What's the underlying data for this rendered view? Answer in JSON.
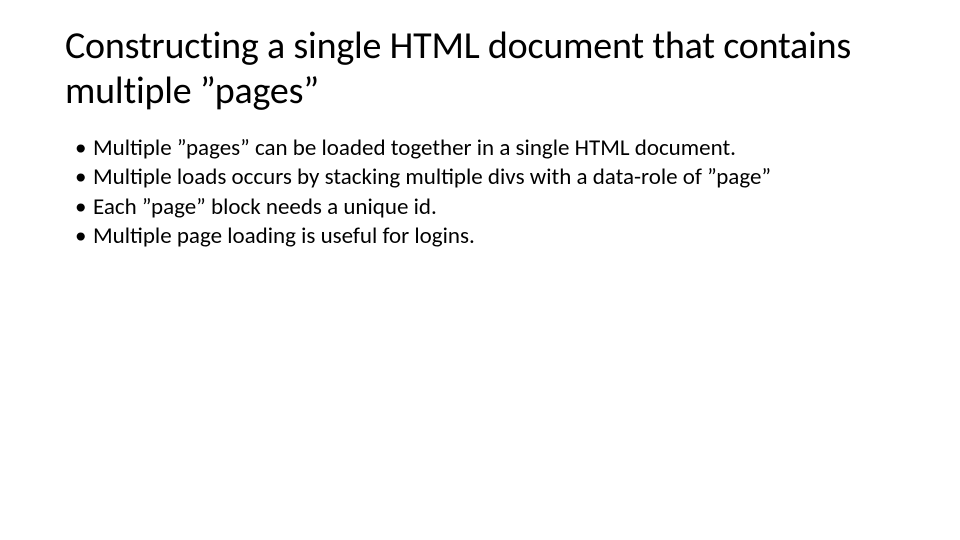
{
  "slide": {
    "title": "Constructing a single HTML document that contains multiple ”pages”",
    "bullets": [
      "Multiple ”pages” can be loaded together in a single HTML document.",
      "Multiple loads occurs by stacking multiple divs with a data-role of ”page”",
      "Each ”page” block needs a unique id.",
      "Multiple page loading is useful for logins."
    ]
  }
}
